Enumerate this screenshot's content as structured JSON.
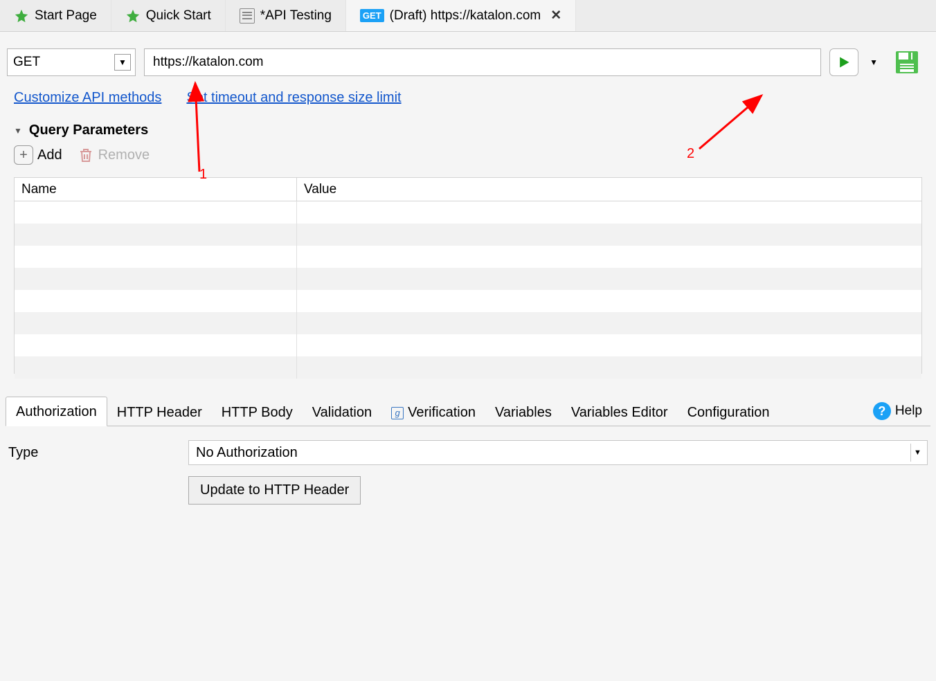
{
  "tabs": [
    {
      "label": "Start Page"
    },
    {
      "label": "Quick Start"
    },
    {
      "label": "*API Testing"
    },
    {
      "label": "(Draft) https://katalon.com"
    }
  ],
  "request": {
    "method": "GET",
    "url": "https://katalon.com"
  },
  "links": {
    "customize": "Customize API methods",
    "timeout": "Set timeout and response size limit"
  },
  "queryParams": {
    "title": "Query Parameters",
    "add": "Add",
    "remove": "Remove",
    "cols": {
      "name": "Name",
      "value": "Value"
    }
  },
  "bottomTabs": {
    "authorization": "Authorization",
    "httpHeader": "HTTP Header",
    "httpBody": "HTTP Body",
    "validation": "Validation",
    "verification": "Verification",
    "variables": "Variables",
    "variablesEditor": "Variables Editor",
    "configuration": "Configuration",
    "help": "Help"
  },
  "auth": {
    "typeLabel": "Type",
    "typeValue": "No Authorization",
    "updateBtn": "Update to HTTP Header"
  },
  "annotations": {
    "one": "1",
    "two": "2"
  }
}
